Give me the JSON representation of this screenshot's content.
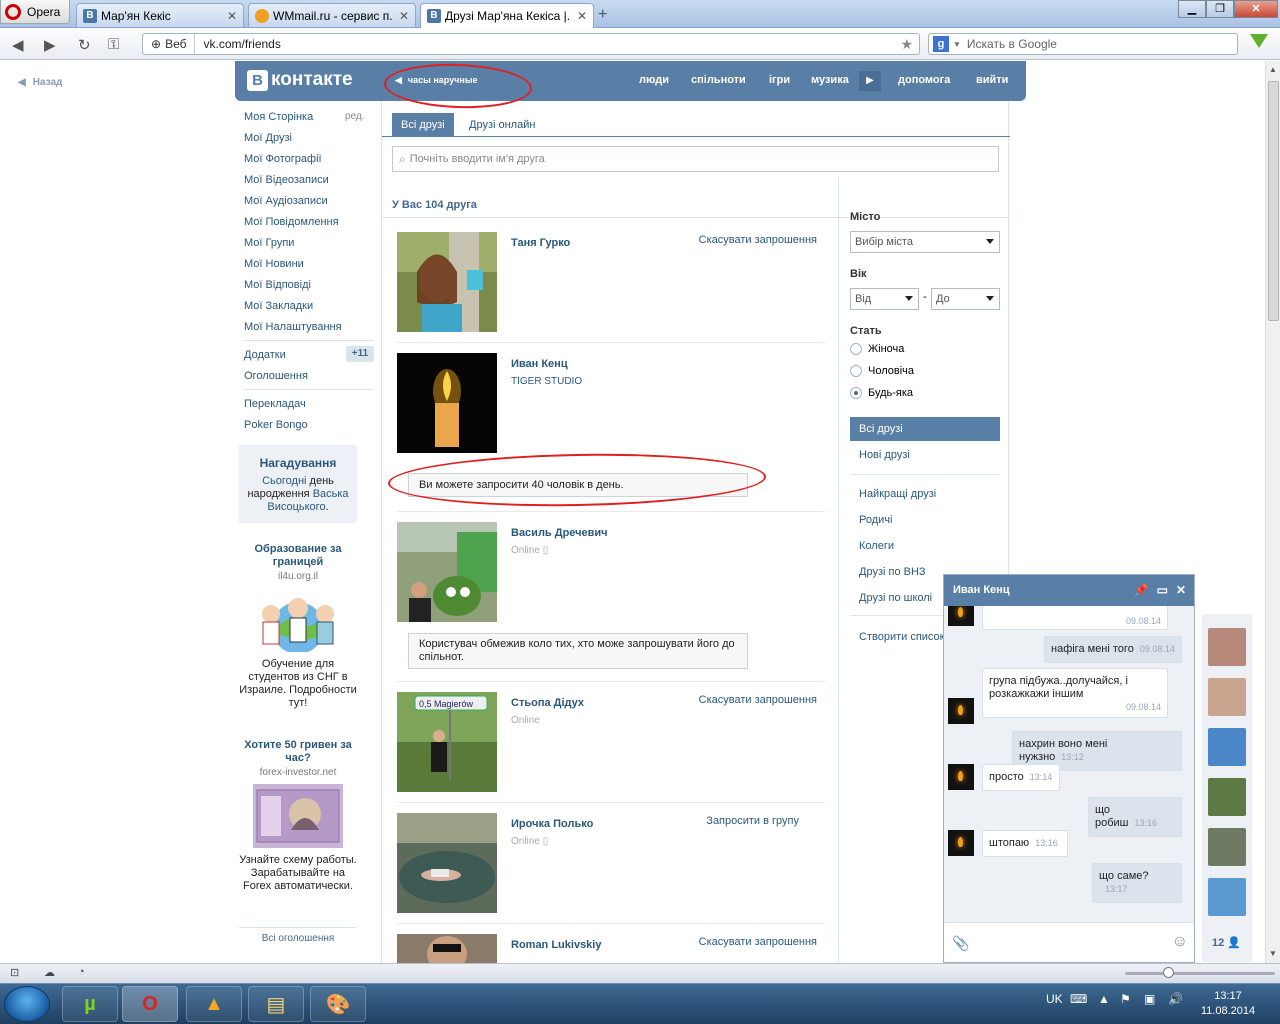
{
  "browser": {
    "menu_label": "Opera",
    "tabs": [
      {
        "favicon": "B",
        "label": "Мар'ян Кекіс"
      },
      {
        "favicon": "",
        "label": "WMmail.ru - сервис п..."
      },
      {
        "favicon": "B",
        "label": "Друзі Мар'яна Кекіса |..."
      }
    ],
    "address": {
      "mode": "Веб",
      "url": "vk.com/friends"
    },
    "search_placeholder": "Искать в Google"
  },
  "vk": {
    "back_label": "Назад",
    "logo_text": "контакте",
    "logo_letter": "В",
    "search_query": "часы наручные",
    "nav": [
      "люди",
      "спільноти",
      "ігри",
      "музика",
      "допомога",
      "вийти"
    ],
    "left_menu": [
      "Моя Сторінка",
      "Мої Друзі",
      "Мої Фотографії",
      "Мої Відеозаписи",
      "Мої Аудіозаписи",
      "Мої Повідомлення",
      "Мої Групи",
      "Мої Новини",
      "Мої Відповіді",
      "Мої Закладки",
      "Мої Налаштування"
    ],
    "edit_label": "ред.",
    "apps_label": "Додатки",
    "apps_badge": "+11",
    "ads_label": "Оголошення",
    "extra_menu": [
      "Перекладач",
      "Poker Bongo"
    ],
    "reminder": {
      "title": "Нагадування",
      "today": "Сьогодні",
      "text_mid": "день народження",
      "person": "Васька Висоцького",
      "dot": "."
    },
    "ads": [
      {
        "title": "Образование за границей",
        "domain": "il4u.org.il",
        "text": "Обучение для студентов из СНГ в Израиле. Подробности тут!"
      },
      {
        "title": "Хотите 50 гривен за час?",
        "domain": "forex-investor.net",
        "text": "Узнайте схему работы. Зарабатывайте на Forex автоматически."
      }
    ],
    "all_ads_label": "Всі оголошення",
    "friends": {
      "tabs": [
        "Всі друзі",
        "Друзі онлайн"
      ],
      "search_placeholder": "Почніть вводити ім'я друга",
      "count_text": "У Вас 104 друга",
      "list": [
        {
          "name": "Таня Гурко",
          "sub": "",
          "action": "Скасувати запрошення"
        },
        {
          "name": "Иван Кенц",
          "sub": "TIGER STUDIO",
          "action": ""
        },
        {
          "name": "Василь Дречевич",
          "sub": "Online",
          "action": ""
        },
        {
          "name": "Стьопа Дідух",
          "sub": "Online",
          "action": "Скасувати запрошення"
        },
        {
          "name": "Ирочка Полько",
          "sub": "Online",
          "action": "Запросити в групу"
        },
        {
          "name": "Roman Lukivskiy",
          "sub": "",
          "action": "Скасувати запрошення"
        }
      ],
      "notice_invite_limit": "Ви можете запросити 40 чоловік в день.",
      "notice_restricted": "Користувач обмежив коло тих, хто може запрошувати його до спільнот."
    },
    "filter": {
      "city_label": "Місто",
      "city_value": "Вибір міста",
      "age_label": "Вік",
      "age_from": "Від",
      "age_dash": "-",
      "age_to": "До",
      "sex_label": "Стать",
      "sex_options": [
        "Жіноча",
        "Чоловіча",
        "Будь-яка"
      ],
      "sex_selected": 2,
      "lists": [
        "Всі друзі",
        "Нові друзі"
      ],
      "groups": [
        "Найкращі друзі",
        "Родичі",
        "Колеги",
        "Друзі по ВНЗ",
        "Друзі по школі"
      ],
      "create_list": "Створити список"
    },
    "chat": {
      "title": "Иван Кенц",
      "messages": [
        {
          "dir": "in",
          "text": "",
          "time": "09.08.14"
        },
        {
          "dir": "out",
          "text": "нафіга мені того",
          "time": "09.08.14"
        },
        {
          "dir": "in",
          "text": "група підбужа..долучайся, і розкажкажи іншим",
          "time": "09.08.14"
        },
        {
          "dir": "out",
          "text": "нахрин воно мені нужзно",
          "time": "13:12"
        },
        {
          "dir": "in",
          "text": "просто",
          "time": "13:14"
        },
        {
          "dir": "out",
          "text": "що робиш",
          "time": "13:16"
        },
        {
          "dir": "in",
          "text": "штопаю",
          "time": "13:16"
        },
        {
          "dir": "out",
          "text": "що саме?",
          "time": "13:17"
        }
      ],
      "online_count": "12"
    }
  },
  "taskbar": {
    "lang": "UK",
    "time": "13:17",
    "date": "11.08.2014"
  },
  "colors": {
    "vk_blue": "#5a7fa6",
    "vk_link": "#2b587a",
    "annotation_red": "#e02020"
  }
}
